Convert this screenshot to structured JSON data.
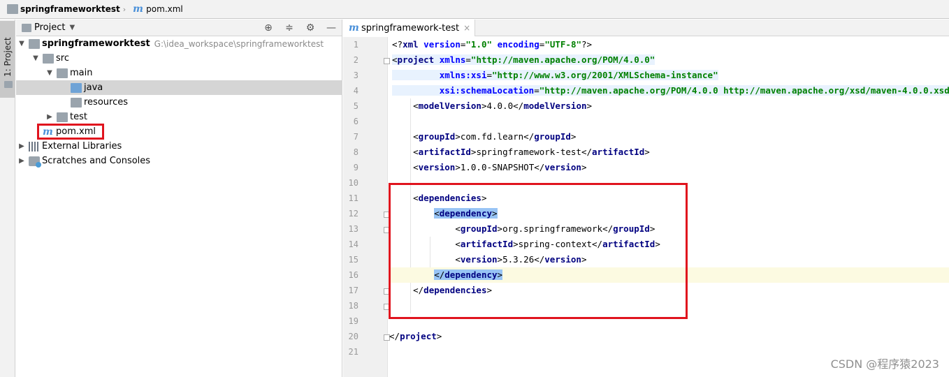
{
  "breadcrumb": {
    "project": "springframeworktest",
    "file": "pom.xml"
  },
  "tool_strip": {
    "label": "1: Project"
  },
  "project_panel": {
    "title": "Project",
    "tree": [
      {
        "label": "springframeworktest",
        "path": "G:\\idea_workspace\\springframeworktest"
      },
      {
        "label": "src"
      },
      {
        "label": "main"
      },
      {
        "label": "java"
      },
      {
        "label": "resources"
      },
      {
        "label": "test"
      },
      {
        "label": "pom.xml"
      },
      {
        "label": "External Libraries"
      },
      {
        "label": "Scratches and Consoles"
      }
    ]
  },
  "editor": {
    "tab_label": "springframework-test",
    "line_numbers": [
      "1",
      "2",
      "3",
      "4",
      "5",
      "6",
      "7",
      "8",
      "9",
      "10",
      "11",
      "12",
      "13",
      "14",
      "15",
      "16",
      "17",
      "18",
      "19",
      "20",
      "21"
    ],
    "xml": {
      "decl_version": "\"1.0\"",
      "decl_encoding": "\"UTF-8\"",
      "xmlns": "\"http://maven.apache.org/POM/4.0.0\"",
      "xmlns_xsi": "\"http://www.w3.org/2001/XMLSchema-instance\"",
      "schema_location": "\"http://maven.apache.org/POM/4.0.0 http://maven.apache.org/xsd/maven-4.0.0.xsd\"",
      "model_version": "4.0.0",
      "group_id": "com.fd.learn",
      "artifact_id": "springframework-test",
      "version": "1.0.0-SNAPSHOT",
      "dep_group_id": "org.springframework",
      "dep_artifact_id": "spring-context",
      "dep_version": "5.3.26"
    }
  },
  "watermark": "CSDN @程序猿2023"
}
